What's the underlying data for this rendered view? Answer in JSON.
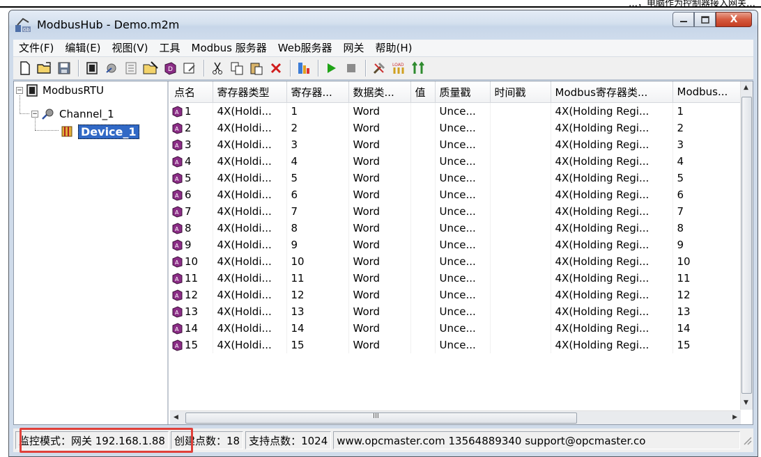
{
  "doc_header": {
    "clipped_text": "…，电脑作为控制器接入网关…"
  },
  "window": {
    "title": "ModbusHub - Demo.m2m",
    "close_label": "X"
  },
  "menubar": [
    "文件(F)",
    "编辑(E)",
    "视图(V)",
    "工具",
    "Modbus 服务器",
    "Web服务器",
    "网关",
    "帮助(H)"
  ],
  "toolbar": {
    "icons": [
      "new-file",
      "open-folder",
      "save",
      "add-channel",
      "add-device",
      "add-point",
      "edit",
      "edit-device",
      "properties",
      "cut",
      "copy",
      "paste",
      "delete",
      "export",
      "run",
      "stop",
      "tools",
      "load-config",
      "upload"
    ],
    "run_color": "#1fa316",
    "delete_color": "#d01c1c"
  },
  "tree": {
    "root": "ModbusRTU",
    "channel": "Channel_1",
    "device": "Device_1"
  },
  "grid": {
    "columns": [
      "点名",
      "寄存器类型",
      "寄存器...",
      "数据类...",
      "值",
      "质量戳",
      "时间戳",
      "Modbus寄存器类...",
      "Modbus..."
    ],
    "rows": [
      [
        "1",
        "4X(Holdi...",
        "1",
        "Word",
        "",
        "Unce...",
        "",
        "4X(Holding Regi...",
        "1"
      ],
      [
        "2",
        "4X(Holdi...",
        "2",
        "Word",
        "",
        "Unce...",
        "",
        "4X(Holding Regi...",
        "2"
      ],
      [
        "3",
        "4X(Holdi...",
        "3",
        "Word",
        "",
        "Unce...",
        "",
        "4X(Holding Regi...",
        "3"
      ],
      [
        "4",
        "4X(Holdi...",
        "4",
        "Word",
        "",
        "Unce...",
        "",
        "4X(Holding Regi...",
        "4"
      ],
      [
        "5",
        "4X(Holdi...",
        "5",
        "Word",
        "",
        "Unce...",
        "",
        "4X(Holding Regi...",
        "5"
      ],
      [
        "6",
        "4X(Holdi...",
        "6",
        "Word",
        "",
        "Unce...",
        "",
        "4X(Holding Regi...",
        "6"
      ],
      [
        "7",
        "4X(Holdi...",
        "7",
        "Word",
        "",
        "Unce...",
        "",
        "4X(Holding Regi...",
        "7"
      ],
      [
        "8",
        "4X(Holdi...",
        "8",
        "Word",
        "",
        "Unce...",
        "",
        "4X(Holding Regi...",
        "8"
      ],
      [
        "9",
        "4X(Holdi...",
        "9",
        "Word",
        "",
        "Unce...",
        "",
        "4X(Holding Regi...",
        "9"
      ],
      [
        "10",
        "4X(Holdi...",
        "10",
        "Word",
        "",
        "Unce...",
        "",
        "4X(Holding Regi...",
        "10"
      ],
      [
        "11",
        "4X(Holdi...",
        "11",
        "Word",
        "",
        "Unce...",
        "",
        "4X(Holding Regi...",
        "11"
      ],
      [
        "12",
        "4X(Holdi...",
        "12",
        "Word",
        "",
        "Unce...",
        "",
        "4X(Holding Regi...",
        "12"
      ],
      [
        "13",
        "4X(Holdi...",
        "13",
        "Word",
        "",
        "Unce...",
        "",
        "4X(Holding Regi...",
        "13"
      ],
      [
        "14",
        "4X(Holdi...",
        "14",
        "Word",
        "",
        "Unce...",
        "",
        "4X(Holding Regi...",
        "14"
      ],
      [
        "15",
        "4X(Holdi...",
        "15",
        "Word",
        "",
        "Unce...",
        "",
        "4X(Holding Regi...",
        "15"
      ]
    ],
    "hscroll_label": "III"
  },
  "statusbar": {
    "mode": "监控模式：网关 192.168.1.88",
    "created": "创建点数：18",
    "supported": "支持点数：1024",
    "contact": "www.opcmaster.com 13564889340 support@opcmaster.co"
  },
  "colors": {
    "highlight": "#e0403a",
    "selection": "#3169c6",
    "accent": "#cfdbea"
  }
}
